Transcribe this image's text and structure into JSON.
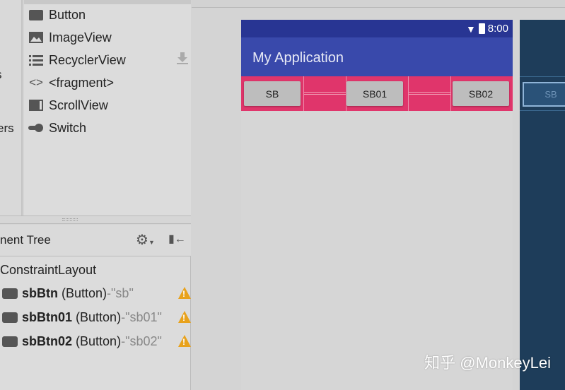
{
  "left_column": {
    "items": [
      "s",
      "ers"
    ]
  },
  "palette": {
    "items": [
      {
        "label": "Button",
        "icon": "button-icon"
      },
      {
        "label": "ImageView",
        "icon": "image-icon"
      },
      {
        "label": "RecyclerView",
        "icon": "list-icon"
      },
      {
        "label": "<fragment>",
        "icon": "code-icon"
      },
      {
        "label": "ScrollView",
        "icon": "scrollview-icon"
      },
      {
        "label": "Switch",
        "icon": "switch-icon"
      }
    ]
  },
  "component_tree": {
    "title": "nent Tree",
    "root": "ConstraintLayout",
    "items": [
      {
        "id": "sbBtn",
        "type": "(Button)",
        "sep": " - ",
        "text": "\"sb\""
      },
      {
        "id": "sbBtn01",
        "type": "(Button)",
        "sep": " - ",
        "text": "\"sb01\""
      },
      {
        "id": "sbBtn02",
        "type": "(Button)",
        "sep": " - ",
        "text": "\"sb02\""
      }
    ]
  },
  "phone": {
    "time": "8:00",
    "app_title": "My Application",
    "buttons": [
      "SB",
      "SB01",
      "SB02"
    ],
    "colors": {
      "status": "#283593",
      "appbar": "#3949ab",
      "accent": "#e0356b"
    }
  },
  "blueprint": {
    "button": "SB"
  },
  "watermark": "知乎 @MonkeyLei"
}
